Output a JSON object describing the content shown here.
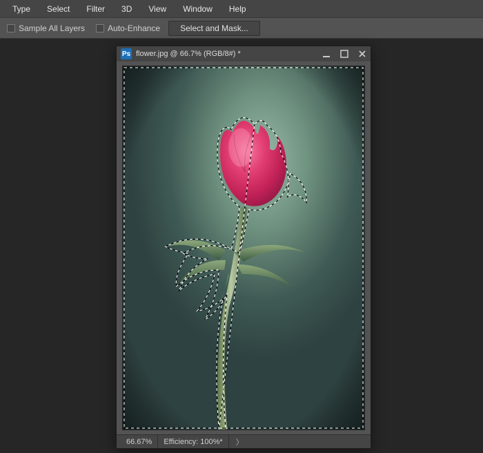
{
  "menubar": {
    "items": [
      {
        "label": "Type"
      },
      {
        "label": "Select"
      },
      {
        "label": "Filter"
      },
      {
        "label": "3D"
      },
      {
        "label": "View"
      },
      {
        "label": "Window"
      },
      {
        "label": "Help"
      }
    ]
  },
  "options": {
    "sample_all_layers": "Sample All Layers",
    "auto_enhance": "Auto-Enhance",
    "select_and_mask": "Select and Mask..."
  },
  "document": {
    "badge": "Ps",
    "title": "flower.jpg @ 66.7% (RGB/8#) *",
    "zoom": "66.67%",
    "efficiency": "Efficiency: 100%*"
  }
}
